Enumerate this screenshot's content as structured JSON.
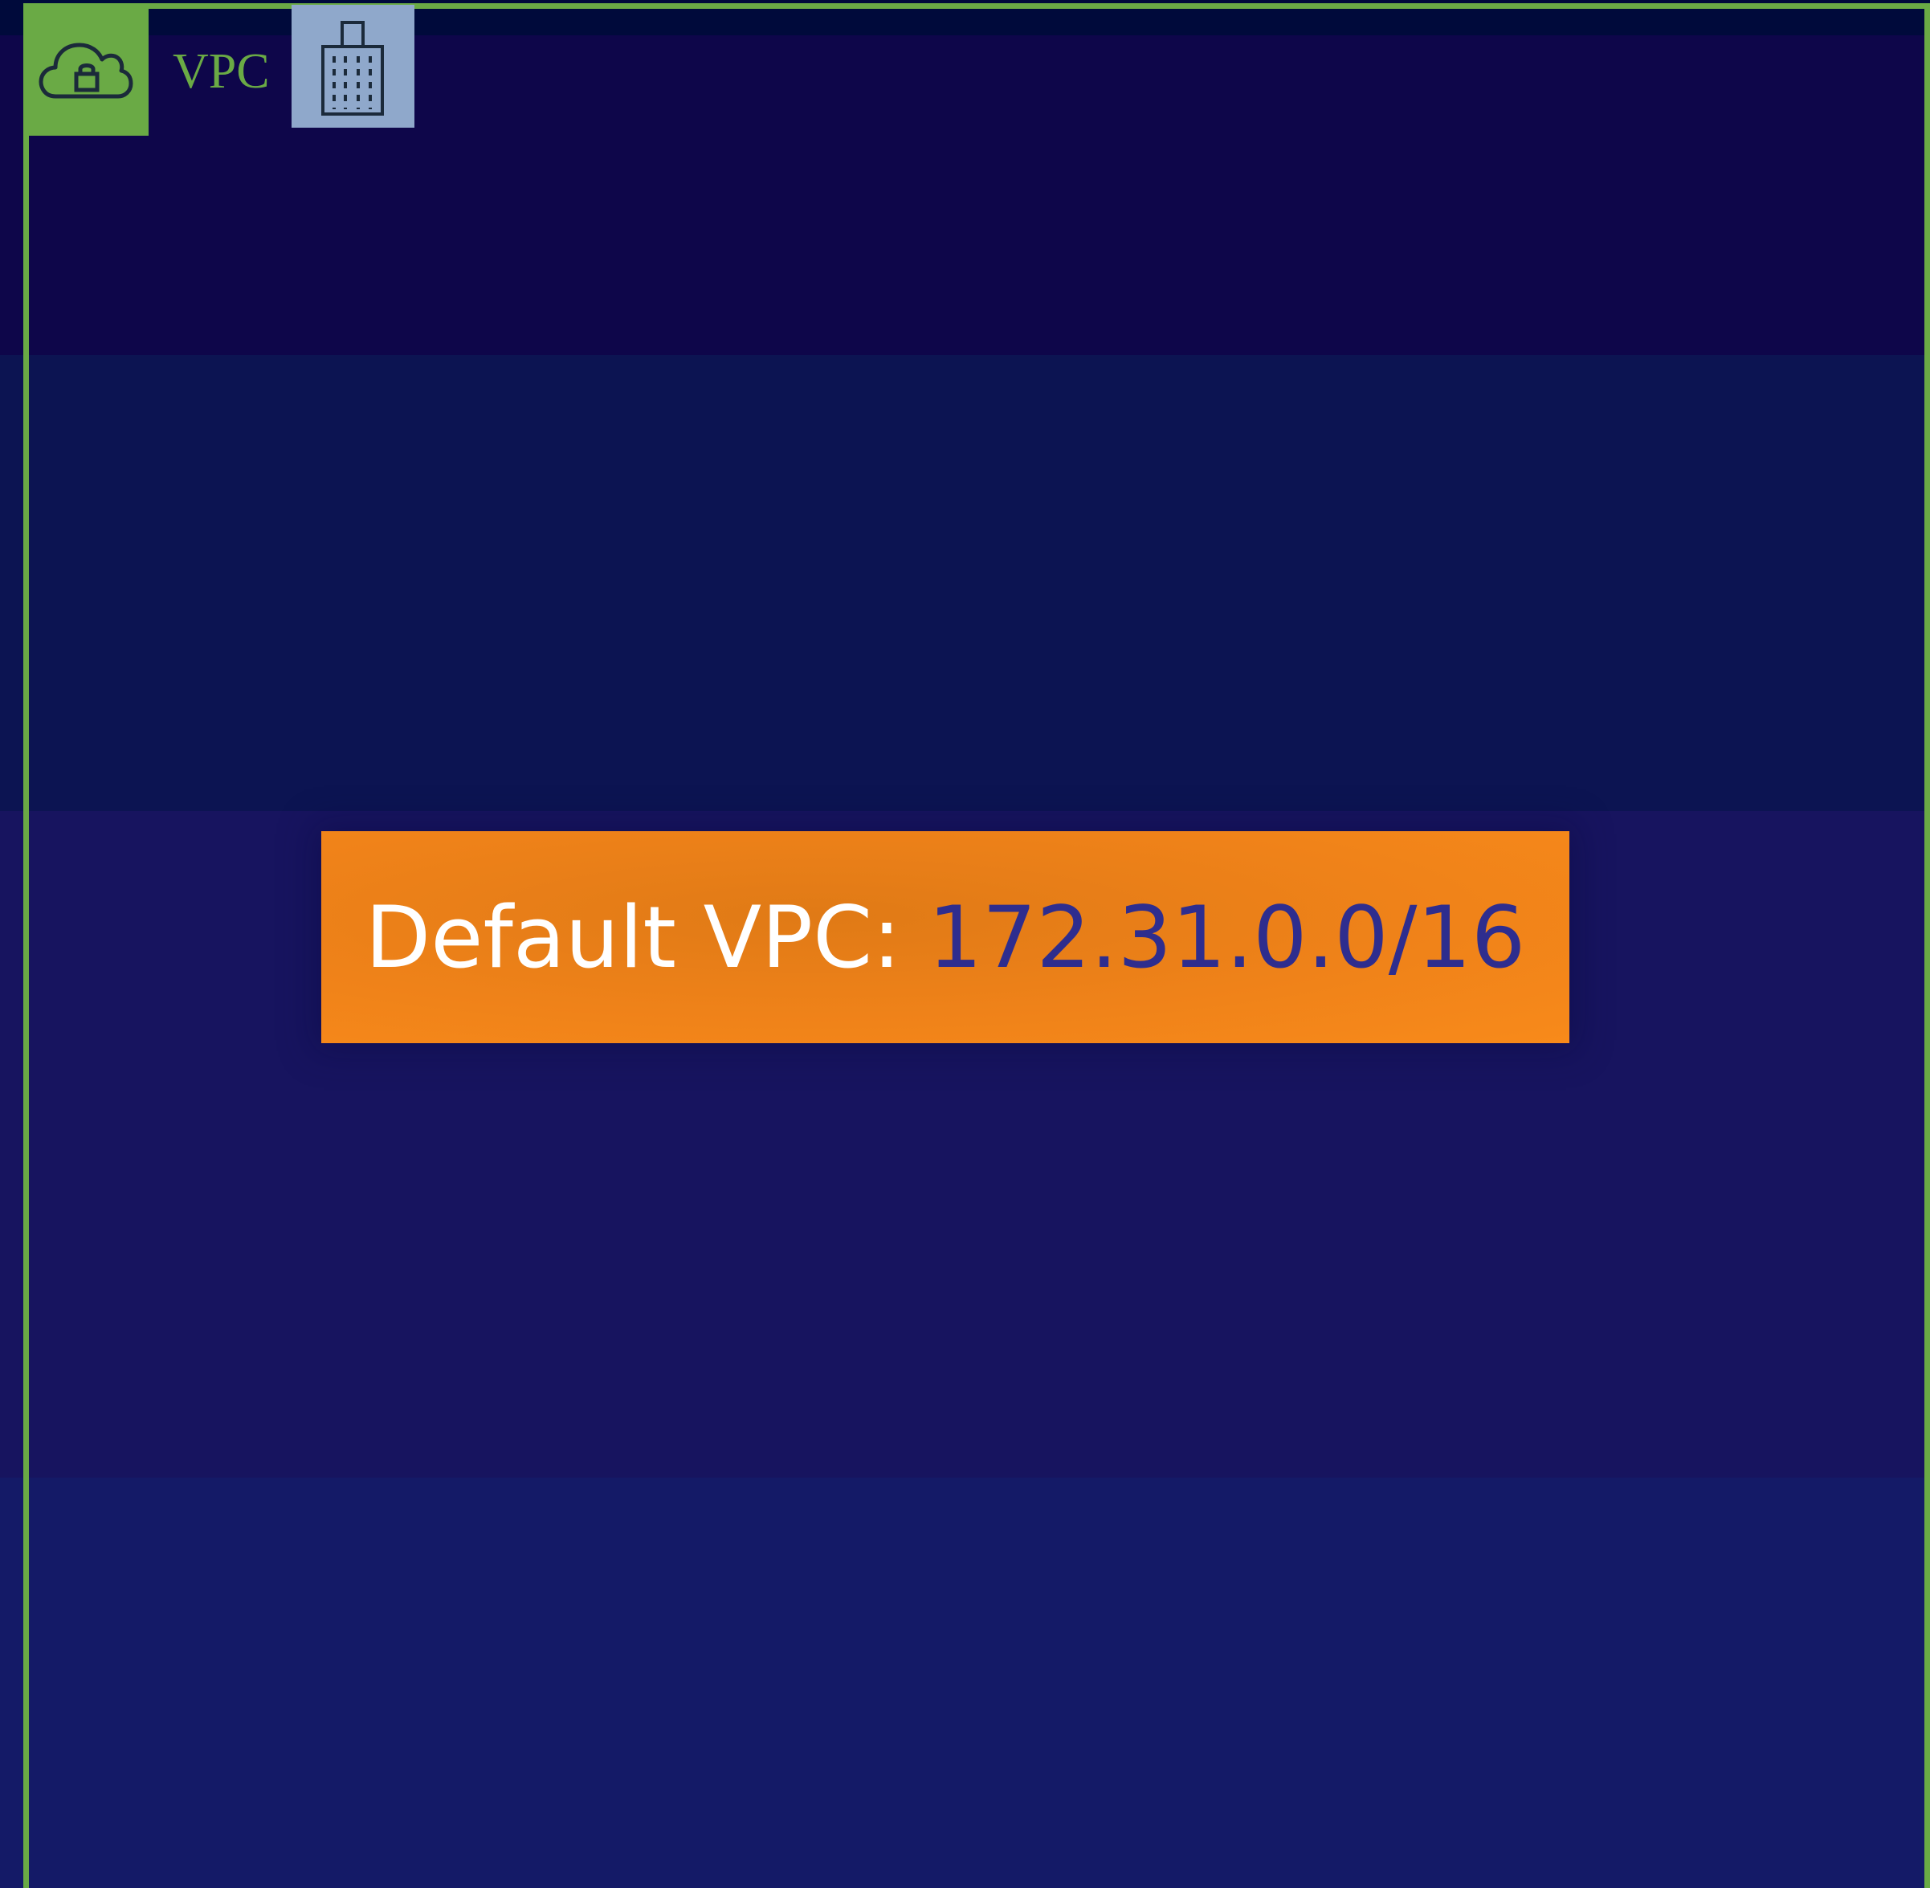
{
  "vpc": {
    "label": "VPC",
    "frame_color": "#6aaa45",
    "icon": "cloud-lock-icon"
  },
  "corporate": {
    "icon": "building-icon",
    "color": "#8fa8cb"
  },
  "default_vpc": {
    "label": "Default VPC:",
    "cidr": "172.31.0.0/16",
    "box_color": "#f0841a",
    "label_color": "#ffffff",
    "cidr_color": "#2e2d8e"
  }
}
